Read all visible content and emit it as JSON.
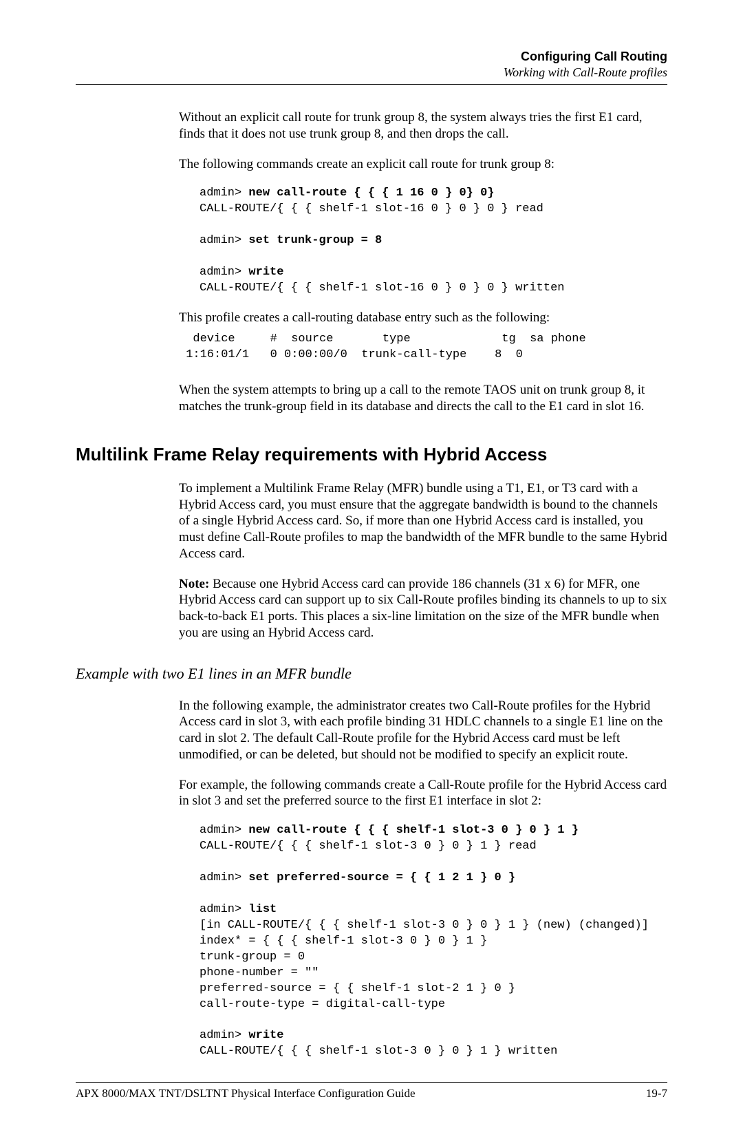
{
  "header": {
    "title": "Configuring Call Routing",
    "subtitle": "Working with Call-Route profiles"
  },
  "para1": "Without an explicit call route for trunk group 8, the system always tries the first E1 card, finds that it does not use trunk group 8, and then drops the call.",
  "para2": "The following commands create an explicit call route for trunk group 8:",
  "code1": {
    "l1a": "admin> ",
    "l1b": "new call-route { { { 1 16 0 } 0} 0}",
    "l2": "CALL-ROUTE/{ { { shelf-1 slot-16 0 } 0 } 0 } read",
    "l3a": "admin> ",
    "l3b": "set trunk-group = 8",
    "l4a": "admin> ",
    "l4b": "write",
    "l5": "CALL-ROUTE/{ { { shelf-1 slot-16 0 } 0 } 0 } written"
  },
  "para3": "This profile creates a call-routing database entry such as the following:",
  "table1": {
    "header": "  device     #  source       type             tg  sa phone",
    "row": " 1:16:01/1   0 0:00:00/0  trunk-call-type    8  0"
  },
  "para4": "When the system attempts to bring up a call to the remote TAOS unit on trunk group 8, it matches the trunk-group field in its database and directs the call to the E1 card in slot 16.",
  "heading2": "Multilink Frame Relay requirements with Hybrid Access",
  "para5": "To implement a Multilink Frame Relay (MFR) bundle using a T1, E1, or T3 card with a Hybrid Access card, you must ensure that the aggregate bandwidth is bound to the channels of a single Hybrid Access card. So, if more than one Hybrid Access card is installed, you must define Call-Route profiles to map the bandwidth of the MFR bundle to the same Hybrid Access card.",
  "note_label": "Note:",
  "note_body": "  Because one Hybrid Access card can provide 186 channels (31 x 6) for MFR, one Hybrid Access card can support up to six Call-Route profiles binding its channels to up to six back-to-back E1 ports. This places a six-line limitation on the size of the MFR bundle when you are using an Hybrid Access card.",
  "heading3": "Example with two E1 lines in an MFR bundle",
  "para6": "In the following example, the administrator creates two Call-Route profiles for the Hybrid Access card in slot 3, with each profile binding 31 HDLC channels to a single E1 line on the card in slot 2. The default Call-Route profile for the Hybrid Access card must be left unmodified, or can be deleted, but should not be modified to specify an explicit route.",
  "para7": "For example, the following commands create a Call-Route profile for the Hybrid Access card in slot 3 and set the preferred source to the first E1 interface in slot 2:",
  "code2": {
    "l1a": "admin> ",
    "l1b": "new call-route { { { shelf-1 slot-3 0 } 0 } 1 }",
    "l2": "CALL-ROUTE/{ { { shelf-1 slot-3 0 } 0 } 1 } read",
    "l3a": "admin> ",
    "l3b": "set preferred-source = { { 1 2 1 } 0 }",
    "l4a": "admin> ",
    "l4b": "list",
    "l5": "[in CALL-ROUTE/{ { { shelf-1 slot-3 0 } 0 } 1 } (new) (changed)]",
    "l6": "index* = { { { shelf-1 slot-3 0 } 0 } 1 }",
    "l7": "trunk-group = 0",
    "l8": "phone-number = \"\"",
    "l9": "preferred-source = { { shelf-1 slot-2 1 } 0 }",
    "l10": "call-route-type = digital-call-type",
    "l11a": "admin> ",
    "l11b": "write",
    "l12": "CALL-ROUTE/{ { { shelf-1 slot-3 0 } 0 } 1 } written"
  },
  "footer": {
    "left": "APX 8000/MAX TNT/DSLTNT Physical Interface Configuration Guide",
    "right": "19-7"
  }
}
